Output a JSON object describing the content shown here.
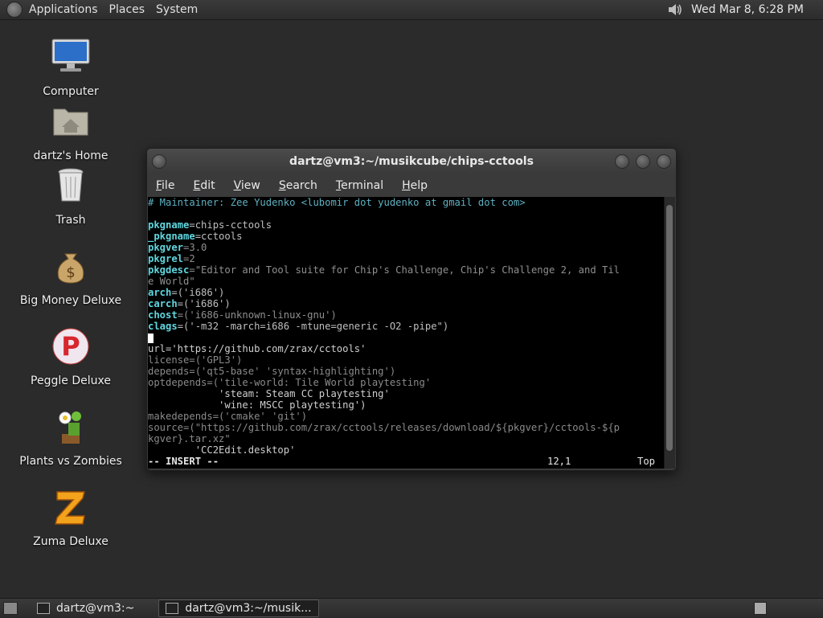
{
  "top_panel": {
    "menus": [
      "Applications",
      "Places",
      "System"
    ],
    "clock": "Wed Mar  8,  6:28 PM"
  },
  "desktop_icons": [
    {
      "label": "Computer"
    },
    {
      "label": "dartz's Home"
    },
    {
      "label": "Trash"
    },
    {
      "label": "Big Money Deluxe"
    },
    {
      "label": "Peggle Deluxe"
    },
    {
      "label": "Plants vs Zombies"
    },
    {
      "label": "Zuma Deluxe"
    }
  ],
  "window": {
    "title": "dartz@vm3:~/musikcube/chips-cctools",
    "menus": [
      "File",
      "Edit",
      "View",
      "Search",
      "Terminal",
      "Help"
    ]
  },
  "terminal": {
    "comment": "# Maintainer: Zee Yudenko <lubomir dot yudenko at gmail dot com>",
    "lines": [
      {
        "key": "pkgname",
        "rest": "=chips-cctools"
      },
      {
        "key": "_pkgname",
        "rest": "=cctools"
      },
      {
        "key": "pkgver",
        "rest": "=3.0"
      },
      {
        "key": "pkgrel",
        "rest": "=2"
      },
      {
        "key": "pkgdesc",
        "rest": "=\"Editor and Tool suite for Chip's Challenge, Chip's Challenge 2, and Til"
      },
      {
        "key": "",
        "rest": "e World\""
      },
      {
        "key": "arch",
        "rest": "=('i686')"
      },
      {
        "key": "carch",
        "rest": "=('i686')"
      },
      {
        "key": "chost",
        "rest": "=('i686-unknown-linux-gnu')"
      },
      {
        "key": "clags",
        "rest": "=('-m32 -march=i686 -mtune=generic -O2 -pipe\")"
      }
    ],
    "lines2": [
      "url='https://github.com/zrax/cctools'",
      "license=('GPL3')",
      "depends=('qt5-base' 'syntax-highlighting')",
      "optdepends=('tile-world: Tile World playtesting'",
      "            'steam: Steam CC playtesting'",
      "            'wine: MSCC playtesting')",
      "makedepends=('cmake' 'git')",
      "source=(\"https://github.com/zrax/cctools/releases/download/${pkgver}/cctools-${p",
      "kgver}.tar.xz\"",
      "        'CC2Edit.desktop'"
    ],
    "mode": "-- INSERT --",
    "position": "12,1",
    "scroll": "Top"
  },
  "bottom_panel": {
    "tasks": [
      "dartz@vm3:~",
      "dartz@vm3:~/musik..."
    ]
  }
}
